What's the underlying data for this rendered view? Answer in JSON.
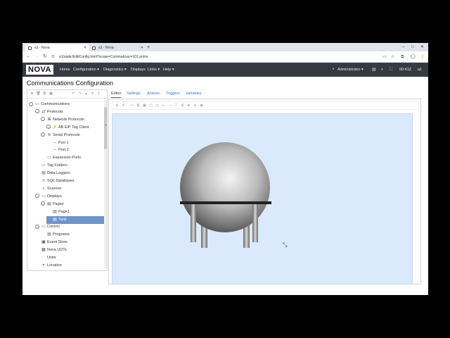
{
  "browser": {
    "tabs": [
      {
        "label": "a1 - Nova",
        "active": true
      },
      {
        "label": "a1 - Nova",
        "active": false
      }
    ],
    "new_tab": "+",
    "window_controls": [
      "–",
      "□",
      "✕"
    ],
    "url": "a1/static/EditConfig.html?scope=Comms&nav=101.prims"
  },
  "app": {
    "logo": "NOVA",
    "menu": [
      "Home",
      "Configuration ▾",
      "Diagnostics ▾",
      "Displays",
      "Links ▾",
      "Help ▾"
    ],
    "user": "Administrator ▾",
    "clock": "00:41Z",
    "station": "a1"
  },
  "page": {
    "title": "Communications Configuration"
  },
  "tree": [
    {
      "label": "Communications",
      "icon": "monitor-icon",
      "toggle": "–",
      "depth": 0
    },
    {
      "label": "Protocols",
      "icon": "protocols-icon",
      "toggle": "–",
      "depth": 1
    },
    {
      "label": "Network Protocols",
      "icon": "network-icon",
      "toggle": "–",
      "depth": 2
    },
    {
      "label": "AB EIP Tag Client",
      "icon": "plug-icon",
      "toggle": "+",
      "depth": 3
    },
    {
      "label": "Serial Protocols",
      "icon": "serial-icon",
      "toggle": "–",
      "depth": 2
    },
    {
      "label": "Port 1",
      "icon": "port-icon",
      "toggle": "",
      "depth": 3
    },
    {
      "label": "Port 2",
      "icon": "port-icon",
      "toggle": "",
      "depth": 3
    },
    {
      "label": "Expansion Ports",
      "icon": "expansion-icon",
      "toggle": "",
      "depth": 2
    },
    {
      "label": "Tag Folders",
      "icon": "folder-icon",
      "toggle": "",
      "depth": 1
    },
    {
      "label": "Data Loggers",
      "icon": "logger-icon",
      "toggle": "",
      "depth": 1
    },
    {
      "label": "SQL Databases",
      "icon": "database-icon",
      "toggle": "",
      "depth": 1
    },
    {
      "label": "Scanner",
      "icon": "scanner-icon",
      "toggle": "",
      "depth": 1
    },
    {
      "label": "Displays",
      "icon": "monitor-icon",
      "toggle": "–",
      "depth": 1
    },
    {
      "label": "Pages",
      "icon": "pages-icon",
      "toggle": "–",
      "depth": 2
    },
    {
      "label": "Page1",
      "icon": "page-icon",
      "toggle": "",
      "depth": 3
    },
    {
      "label": "Tank",
      "icon": "page-icon",
      "toggle": "",
      "depth": 3,
      "selected": true
    },
    {
      "label": "Control",
      "icon": "control-icon",
      "toggle": "–",
      "depth": 1
    },
    {
      "label": "Programs",
      "icon": "program-icon",
      "toggle": "",
      "depth": 2
    },
    {
      "label": "Event Store",
      "icon": "event-icon",
      "toggle": "",
      "depth": 1
    },
    {
      "label": "Nova UDTs",
      "icon": "udt-icon",
      "toggle": "",
      "depth": 1
    },
    {
      "label": "Units",
      "icon": "units-icon",
      "toggle": "",
      "depth": 1
    },
    {
      "label": "Location",
      "icon": "location-icon",
      "toggle": "",
      "depth": 1
    }
  ],
  "editor_tabs": [
    "Editor",
    "Settings",
    "Actions",
    "Triggers",
    "Variables"
  ],
  "colors": {
    "nav_bg": "#353a42",
    "selection": "#6e93c7",
    "canvas_bg": "#dbe9fc",
    "link": "#3a73c0"
  }
}
